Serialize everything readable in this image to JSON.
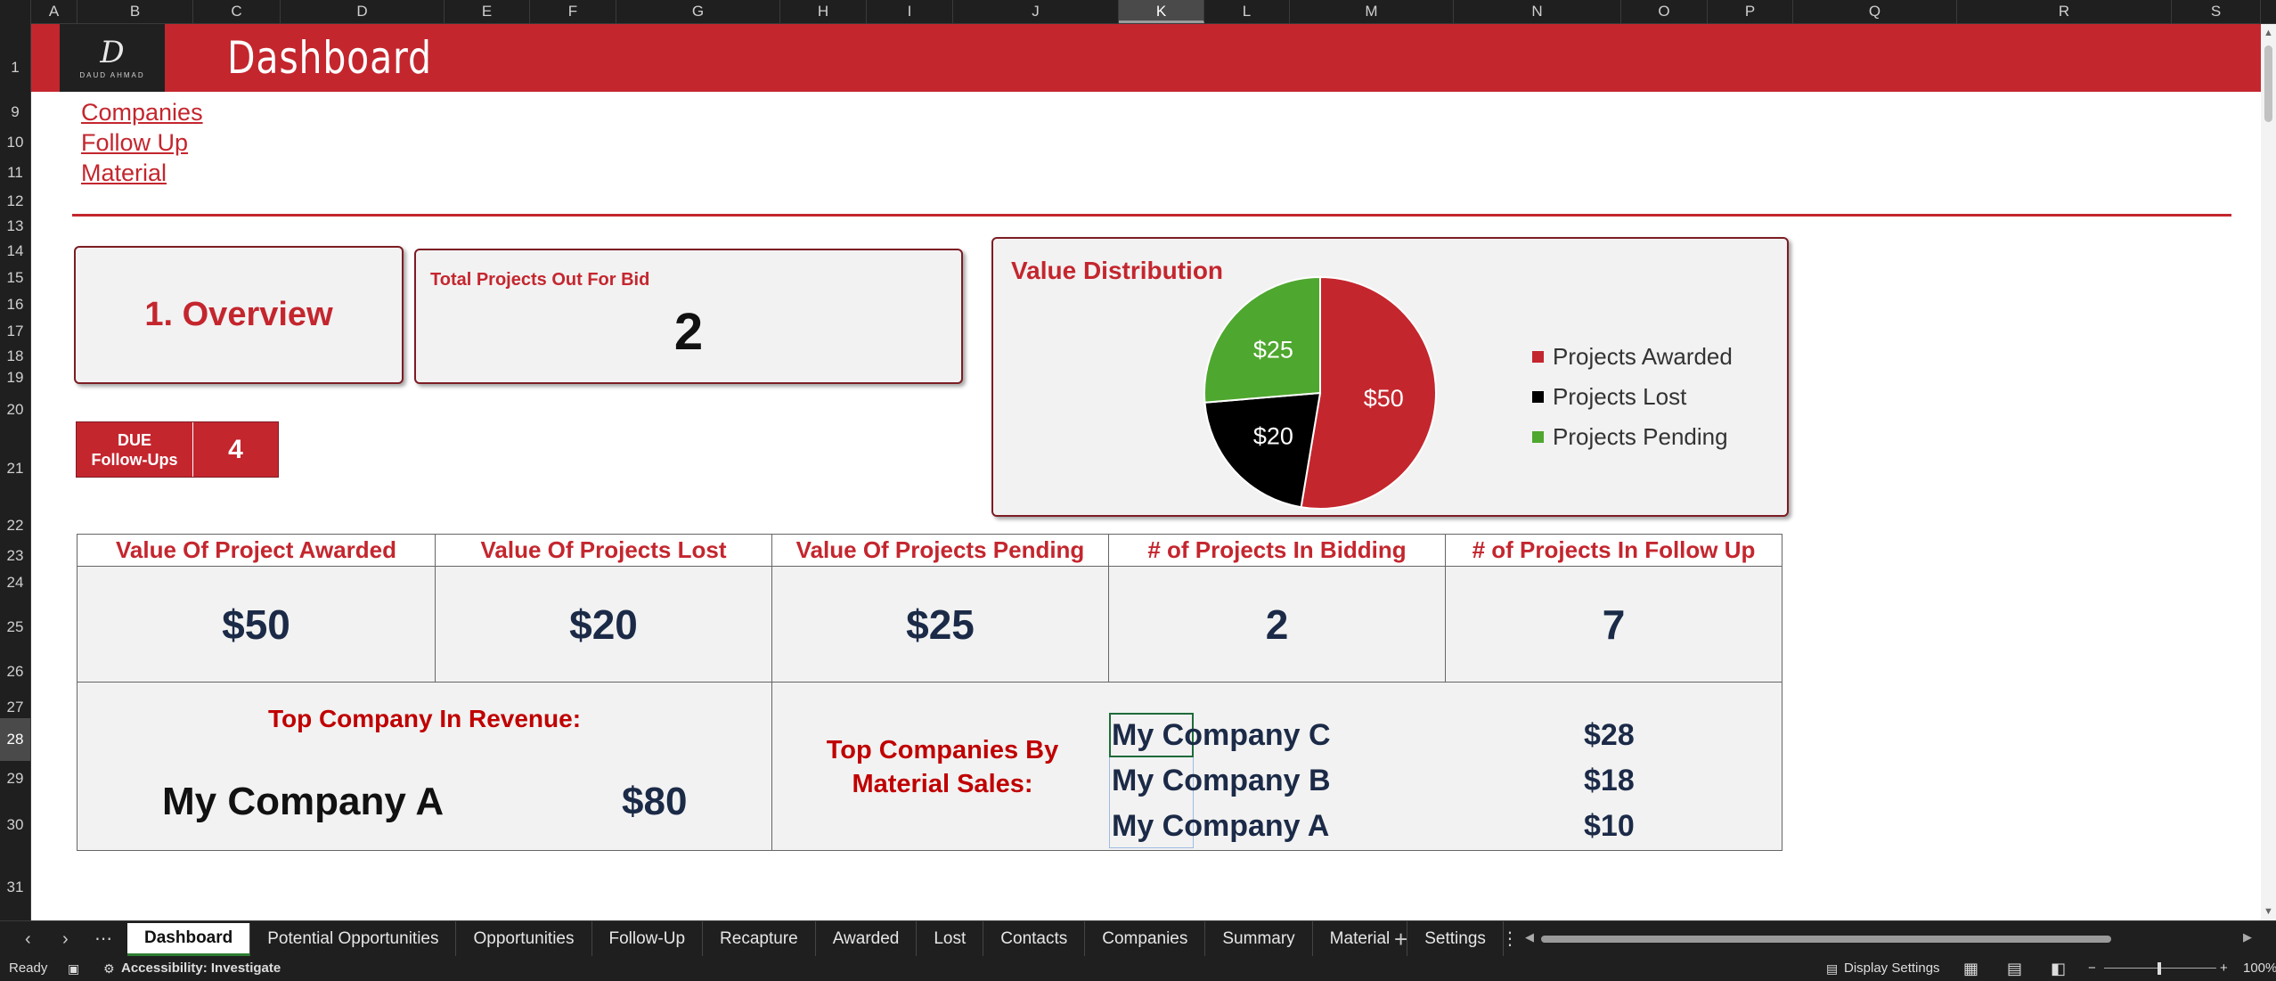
{
  "columns": [
    "A",
    "B",
    "C",
    "D",
    "E",
    "F",
    "G",
    "H",
    "I",
    "J",
    "K",
    "L",
    "M",
    "N",
    "O",
    "P",
    "Q",
    "R",
    "S"
  ],
  "selected_column": "K",
  "rows": [
    "1",
    "9",
    "10",
    "11",
    "12",
    "13",
    "14",
    "15",
    "16",
    "17",
    "18",
    "19",
    "20",
    "21",
    "22",
    "23",
    "24",
    "25",
    "26",
    "27",
    "28",
    "29",
    "30",
    "31"
  ],
  "selected_row": "28",
  "banner": {
    "title": "Dashboard",
    "logo_text": "DAUD AHMAD",
    "logo_mark": "D"
  },
  "links": [
    "Companies",
    "Follow Up",
    "Material"
  ],
  "overview": {
    "title": "1. Overview"
  },
  "bids": {
    "label": "Total Projects Out For Bid",
    "value": "2"
  },
  "due": {
    "label_line1": "DUE",
    "label_line2": "Follow-Ups",
    "value": "4"
  },
  "pie": {
    "title": "Value Distribution",
    "labels": {
      "awarded": "$50",
      "lost": "$20",
      "pending": "$25"
    }
  },
  "chart_data": {
    "type": "pie",
    "title": "Value Distribution",
    "categories": [
      "Projects Awarded",
      "Projects Lost",
      "Projects Pending"
    ],
    "values": [
      50,
      20,
      25
    ],
    "colors": [
      "#c4262e",
      "#000000",
      "#4ea72e"
    ],
    "legend": "right"
  },
  "kpis": {
    "headers": [
      "Value Of Project Awarded",
      "Value Of Projects Lost",
      "Value Of Projects Pending",
      "# of Projects In Bidding",
      "# of Projects In Follow Up"
    ],
    "values": [
      "$50",
      "$20",
      "$25",
      "2",
      "7"
    ]
  },
  "top_company": {
    "title": "Top Company In Revenue:",
    "name": "My Company A",
    "value": "$80"
  },
  "material": {
    "title_line1": "Top Companies By",
    "title_line2": "Material Sales:",
    "rows": [
      {
        "name": "My Company C",
        "value": "$28"
      },
      {
        "name": "My Company B",
        "value": "$18"
      },
      {
        "name": "My Company A",
        "value": "$10"
      }
    ]
  },
  "sheet_tabs": [
    "Dashboard",
    "Potential Opportunities",
    "Opportunities",
    "Follow-Up",
    "Recapture",
    "Awarded",
    "Lost",
    "Contacts",
    "Companies",
    "Summary",
    "Material",
    "Settings"
  ],
  "active_tab": "Dashboard",
  "status": {
    "ready": "Ready",
    "accessibility": "Accessibility: Investigate",
    "display_settings": "Display Settings",
    "zoom": "100%"
  },
  "colors": {
    "brand_red": "#c4262e",
    "pending_green": "#4ea72e",
    "value_navy": "#1b2a47"
  }
}
